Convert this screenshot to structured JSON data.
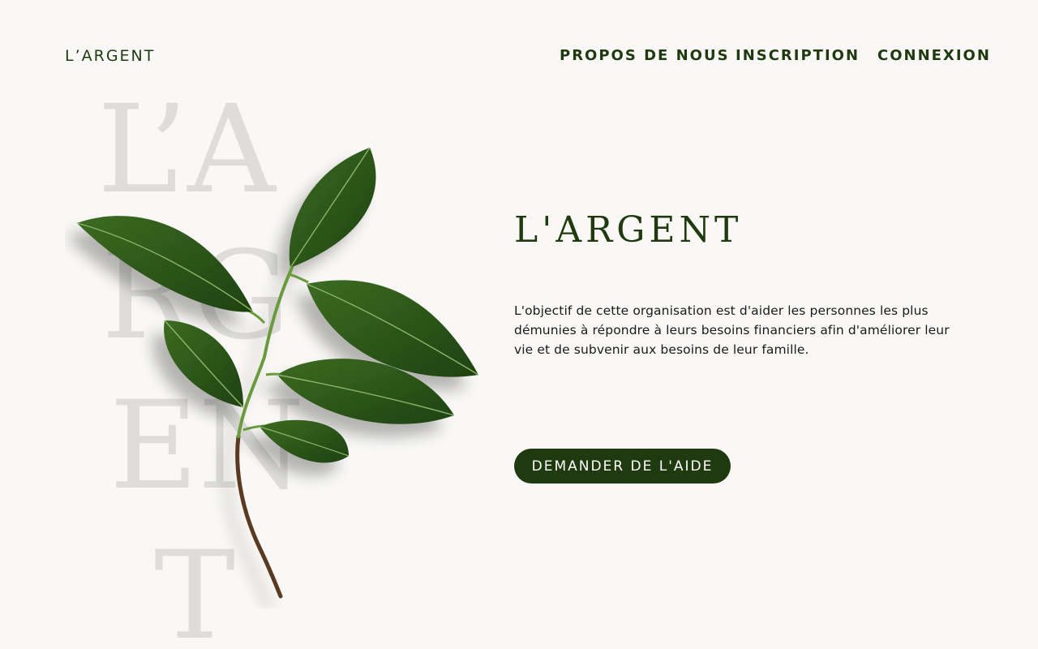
{
  "header": {
    "logo": "L’ARGENT",
    "nav": [
      {
        "label": "PROPOS DE NOUS"
      },
      {
        "label": "INSCRIPTION"
      },
      {
        "label": "CONNEXION"
      }
    ]
  },
  "background_letters": [
    "L’A",
    "RG",
    "EN",
    "T"
  ],
  "hero": {
    "title": "L'ARGENT",
    "description": "L'objectif de cette organisation est d'aider les personnes les plus démunies à répondre à leurs besoins financiers afin d'améliorer leur vie et de subvenir aux besoins de leur famille.",
    "cta_label": "DEMANDER DE L'AIDE",
    "image_icon": "green-leaf-branch-icon"
  },
  "colors": {
    "brand": "#1f3a0e",
    "background": "#f9f8f6",
    "ghost_letters": "#dedddb",
    "leaf": "#2f5a1a",
    "stem": "#5a3a22"
  }
}
